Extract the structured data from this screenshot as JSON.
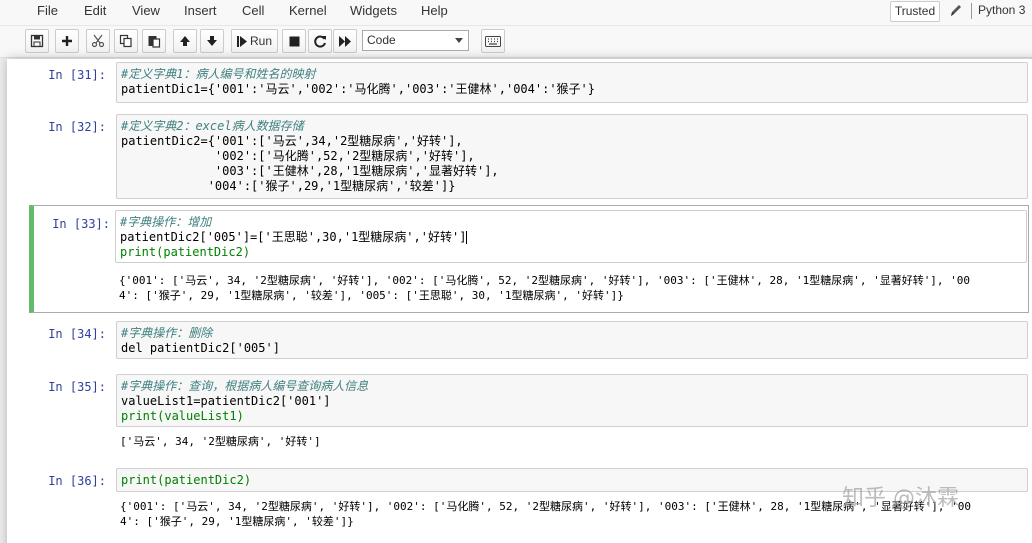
{
  "menubar": {
    "items": [
      "File",
      "Edit",
      "View",
      "Insert",
      "Cell",
      "Kernel",
      "Widgets",
      "Help"
    ],
    "trusted": "Trusted",
    "kernel": "Python 3"
  },
  "toolbar": {
    "run_label": "Run",
    "cell_type": "Code",
    "icons": [
      "save-icon",
      "plus-icon",
      "scissors-icon",
      "copy-icon",
      "paste-icon",
      "arrow-up-icon",
      "arrow-down-icon",
      "run-icon",
      "stop-icon",
      "restart-icon",
      "fast-forward-icon",
      "keyboard-icon"
    ]
  },
  "cells": {
    "c31": {
      "prompt": "In [31]:",
      "line1": "#定义字典1：病人编号和姓名的映射",
      "line2": "patientDic1={'001':'马云','002':'马化腾','003':'王健林','004':'猴子'}"
    },
    "c32": {
      "prompt": "In [32]:",
      "line1": "#定义字典2：excel病人数据存储",
      "line2": "patientDic2={'001':['马云',34,'2型糖尿病','好转'],",
      "line3": "             '002':['马化腾',52,'2型糖尿病','好转'],",
      "line4": "             '003':['王健林',28,'1型糖尿病','显著好转'],",
      "line5": "            '004':['猴子',29,'1型糖尿病','较差']}"
    },
    "c33": {
      "prompt": "In [33]:",
      "line1": "#字典操作：增加",
      "line2": "patientDic2['005']=['王思聪',30,'1型糖尿病','好转']",
      "line3": "print(patientDic2)",
      "out1": "{'001': ['马云', 34, '2型糖尿病', '好转'], '002': ['马化腾', 52, '2型糖尿病', '好转'], '003': ['王健林', 28, '1型糖尿病', '显著好转'], '00",
      "out2": "4': ['猴子', 29, '1型糖尿病', '较差'], '005': ['王思聪', 30, '1型糖尿病', '好转']}"
    },
    "c34": {
      "prompt": "In [34]:",
      "line1": "#字典操作：删除",
      "line2": "del patientDic2['005']"
    },
    "c35": {
      "prompt": "In [35]:",
      "line1": "#字典操作：查询，根据病人编号查询病人信息",
      "line2": "valueList1=patientDic2['001']",
      "line3": "print(valueList1)",
      "out1": "['马云', 34, '2型糖尿病', '好转']"
    },
    "c36": {
      "prompt": "In [36]:",
      "line1": "print(patientDic2)",
      "out1": "{'001': ['马云', 34, '2型糖尿病', '好转'], '002': ['马化腾', 52, '2型糖尿病', '好转'], '003': ['王健林', 28, '1型糖尿病', '显著好转'], '00",
      "out2": "4': ['猴子', 29, '1型糖尿病', '较差']}"
    }
  },
  "watermark": "知乎 @沐霖",
  "colors": {
    "selected_border": "#66bb6a",
    "prompt": "#303f9f",
    "comment": "#408080",
    "string": "#ba2121",
    "builtin": "#008000"
  }
}
